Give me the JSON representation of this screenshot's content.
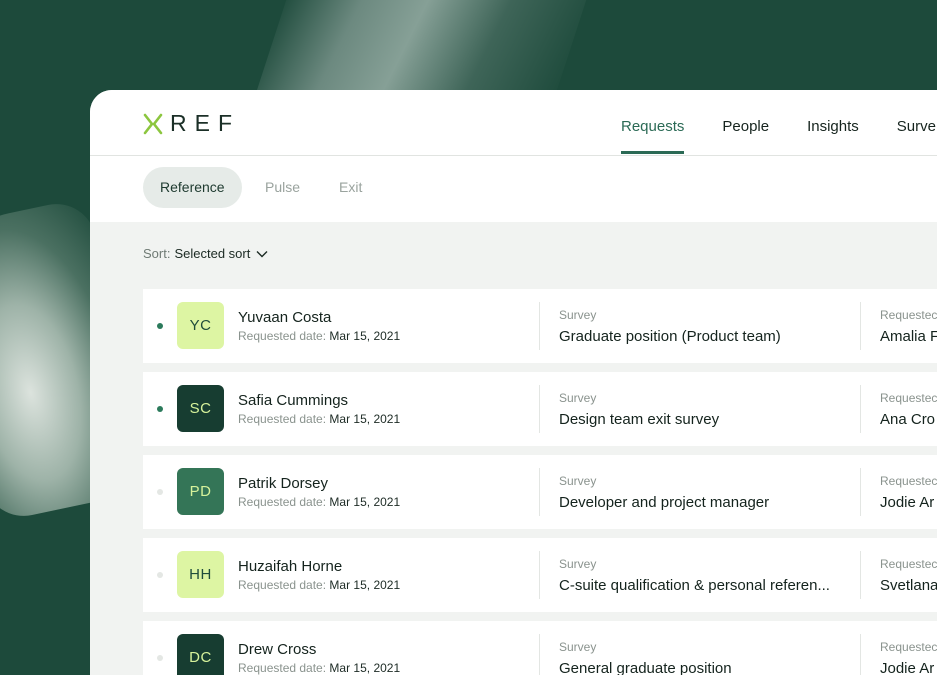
{
  "logo": {
    "text": "REF"
  },
  "nav": {
    "items": [
      {
        "label": "Requests",
        "active": true
      },
      {
        "label": "People"
      },
      {
        "label": "Insights"
      },
      {
        "label": "Surve"
      }
    ]
  },
  "subnav": {
    "pills": [
      {
        "label": "Reference",
        "active": true
      },
      {
        "label": "Pulse"
      },
      {
        "label": "Exit"
      }
    ]
  },
  "sort": {
    "label": "Sort:",
    "value": "Selected sort"
  },
  "rows": [
    {
      "initials": "YC",
      "name": "Yuvaan Costa",
      "date_label": "Requested date:",
      "date": "Mar 15, 2021",
      "survey_label": "Survey",
      "survey": "Graduate position (Product team)",
      "requested_by_label": "Requestec",
      "requested_by": "Amalia F",
      "avatar_bg": "#ddf5a3",
      "avatar_fg": "#1f4d3b",
      "unread": true
    },
    {
      "initials": "SC",
      "name": "Safia Cummings",
      "date_label": "Requested date:",
      "date": "Mar 15, 2021",
      "survey_label": "Survey",
      "survey": "Design team exit survey",
      "requested_by_label": "Requestec",
      "requested_by": "Ana Cro",
      "avatar_bg": "#173d31",
      "avatar_fg": "#d6f29b",
      "unread": true
    },
    {
      "initials": "PD",
      "name": "Patrik Dorsey",
      "date_label": "Requested date:",
      "date": "Mar 15, 2021",
      "survey_label": "Survey",
      "survey": "Developer and project manager",
      "requested_by_label": "Requestec",
      "requested_by": "Jodie Ar",
      "avatar_bg": "#347557",
      "avatar_fg": "#d6f29b",
      "unread": false
    },
    {
      "initials": "HH",
      "name": "Huzaifah Horne",
      "date_label": "Requested date:",
      "date": "Mar 15, 2021",
      "survey_label": "Survey",
      "survey": "C-suite qualification & personal referen...",
      "requested_by_label": "Requestec",
      "requested_by": "Svetlana",
      "avatar_bg": "#ddf5a3",
      "avatar_fg": "#1f4d3b",
      "unread": false
    },
    {
      "initials": "DC",
      "name": "Drew Cross",
      "date_label": "Requested date:",
      "date": "Mar 15, 2021",
      "survey_label": "Survey",
      "survey": "General graduate position",
      "requested_by_label": "Requestec",
      "requested_by": "Jodie Ar",
      "avatar_bg": "#173d31",
      "avatar_fg": "#d6f29b",
      "unread": false
    }
  ],
  "colors": {
    "accent": "#2b6a55",
    "logo_mark": "#8cc63f",
    "unread_dot": "#2b7a5b",
    "read_dot": "#e4e7e4"
  }
}
